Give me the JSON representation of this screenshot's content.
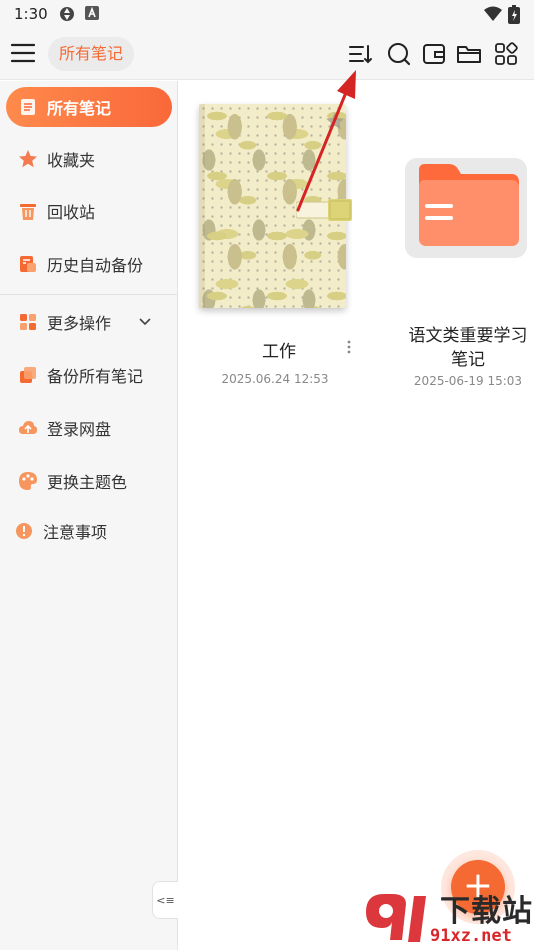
{
  "status_bar": {
    "time": "1:30"
  },
  "app_bar": {
    "title": "所有笔记"
  },
  "sidebar": {
    "items": [
      {
        "label": "所有笔记",
        "icon": "notes-icon",
        "active": true
      },
      {
        "label": "收藏夹",
        "icon": "star-icon"
      },
      {
        "label": "回收站",
        "icon": "trash-icon"
      },
      {
        "label": "历史自动备份",
        "icon": "backup-history-icon"
      }
    ],
    "more": {
      "label": "更多操作",
      "icon": "grid-apps-icon"
    },
    "extra": [
      {
        "label": "备份所有笔记",
        "icon": "backup-icon"
      },
      {
        "label": "登录网盘",
        "icon": "cloud-upload-icon"
      },
      {
        "label": "更换主题色",
        "icon": "palette-icon"
      },
      {
        "label": "注意事项",
        "icon": "info-icon"
      }
    ],
    "collapse_glyph": "<≡"
  },
  "cards": [
    {
      "title": "工作",
      "date": "2025.06.24 12:53",
      "type": "notebook"
    },
    {
      "title_line1": "语文类重要学习",
      "title_line2": "笔记",
      "date": "2025-06-19 15:03",
      "type": "folder"
    }
  ],
  "fab": {
    "label": "+"
  },
  "watermark": {
    "line1": "下载站",
    "line2": "91xz.net"
  },
  "colors": {
    "accent": "#f46a32",
    "annotation_arrow": "#d42424"
  }
}
